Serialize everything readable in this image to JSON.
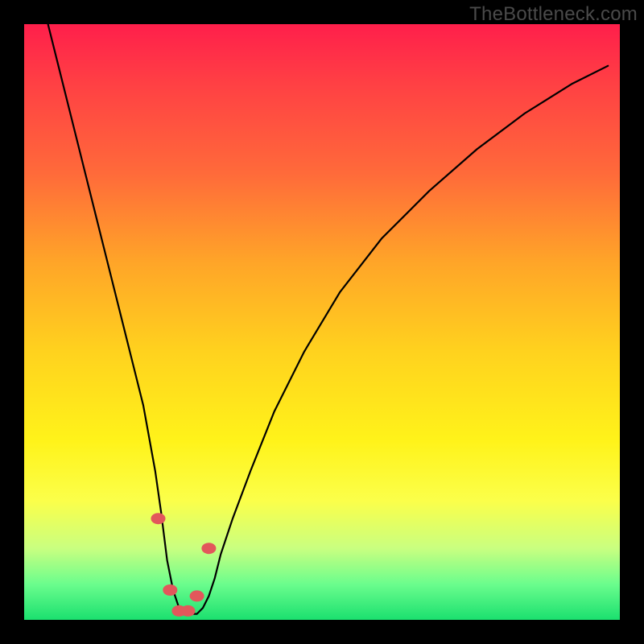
{
  "watermark": "TheBottleneck.com",
  "chart_data": {
    "type": "line",
    "title": "",
    "xlabel": "",
    "ylabel": "",
    "xlim": [
      0,
      100
    ],
    "ylim": [
      0,
      100
    ],
    "grid": false,
    "legend": false,
    "series": [
      {
        "name": "bottleneck-curve",
        "x": [
          4,
          6,
          8,
          10,
          12,
          14,
          16,
          18,
          20,
          22,
          23,
          24,
          25,
          26,
          27,
          28,
          29,
          30,
          31,
          32,
          33,
          35,
          38,
          42,
          47,
          53,
          60,
          68,
          76,
          84,
          92,
          98
        ],
        "y": [
          100,
          92,
          84,
          76,
          68,
          60,
          52,
          44,
          36,
          25,
          18,
          10,
          5,
          2,
          1,
          1,
          1,
          2,
          4,
          7,
          11,
          17,
          25,
          35,
          45,
          55,
          64,
          72,
          79,
          85,
          90,
          93
        ]
      }
    ],
    "markers": {
      "name": "highlight-dots",
      "x": [
        22.5,
        24.5,
        26.0,
        27.5,
        29.0,
        31.0
      ],
      "y": [
        17,
        5,
        1.5,
        1.5,
        4,
        12
      ]
    },
    "gradient_meaning": "background color encodes bottleneck severity: red=high, green=low"
  }
}
